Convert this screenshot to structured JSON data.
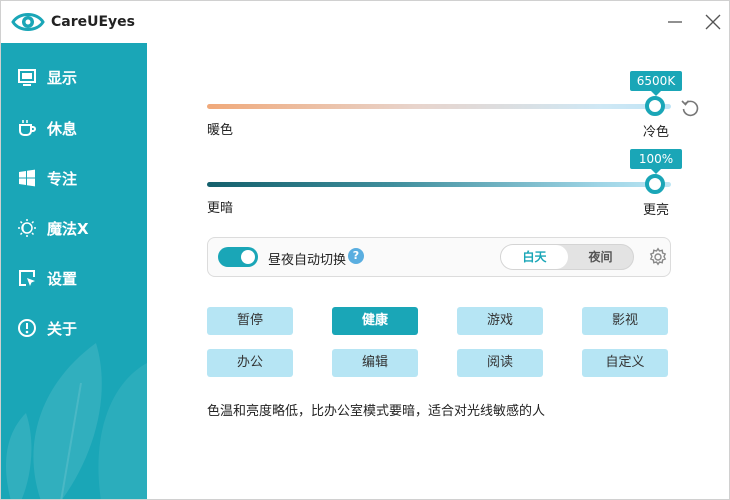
{
  "app": {
    "title": "CareUEyes"
  },
  "sidebar": {
    "items": [
      {
        "label": "显示",
        "icon": "monitor-icon",
        "active": true
      },
      {
        "label": "休息",
        "icon": "coffee-cup-icon",
        "active": false
      },
      {
        "label": "专注",
        "icon": "windows-logo-icon",
        "active": false
      },
      {
        "label": "魔法X",
        "icon": "sun-moon-icon",
        "active": false
      },
      {
        "label": "设置",
        "icon": "cursor-box-icon",
        "active": false
      },
      {
        "label": "关于",
        "icon": "info-icon",
        "active": false
      }
    ]
  },
  "temperature": {
    "value_label": "6500K",
    "left_label": "暖色",
    "right_label": "冷色",
    "level_fraction": 1.0
  },
  "brightness": {
    "value_label": "100%",
    "left_label": "更暗",
    "right_label": "更亮",
    "level_fraction": 1.0
  },
  "auto_switch": {
    "label": "昼夜自动切换",
    "help": "?",
    "enabled": true,
    "day_label": "白天",
    "night_label": "夜间",
    "selected": "白天"
  },
  "modes": [
    {
      "label": "暂停",
      "active": false
    },
    {
      "label": "健康",
      "active": true
    },
    {
      "label": "游戏",
      "active": false
    },
    {
      "label": "影视",
      "active": false
    },
    {
      "label": "办公",
      "active": false
    },
    {
      "label": "编辑",
      "active": false
    },
    {
      "label": "阅读",
      "active": false
    },
    {
      "label": "自定义",
      "active": false
    }
  ],
  "description": "色温和亮度略低，比办公室模式要暗，适合对光线敏感的人",
  "colors": {
    "accent": "#1aa6b7",
    "mode_button": "#b6e5f4"
  }
}
